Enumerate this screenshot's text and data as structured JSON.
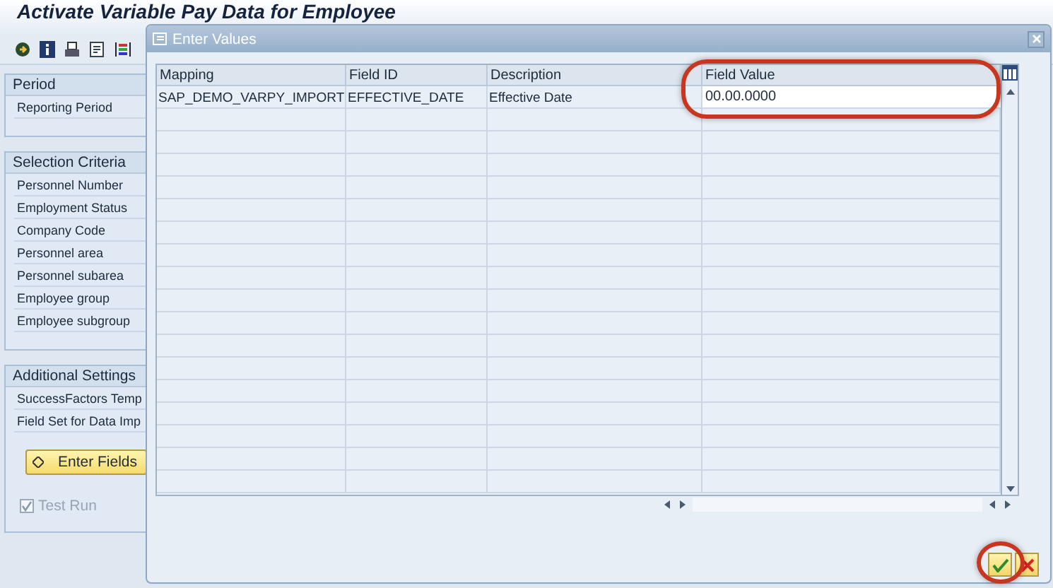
{
  "app": {
    "title": "Activate Variable Pay Data for Employee"
  },
  "groups": [
    {
      "title": "Period",
      "fields": [
        "Reporting Period"
      ]
    },
    {
      "title": "Selection Criteria",
      "fields": [
        "Personnel Number",
        "Employment Status",
        "Company Code",
        "Personnel area",
        "Personnel subarea",
        "Employee group",
        "Employee subgroup"
      ]
    },
    {
      "title": "Additional Settings",
      "fields": [
        "SuccessFactors Temp",
        "Field Set for Data Imp"
      ],
      "button": "Enter Fields",
      "checkbox": {
        "label": "Test Run",
        "checked": true,
        "disabled": true
      }
    }
  ],
  "dialog": {
    "title": "Enter Values",
    "columns": [
      {
        "label": "Mapping",
        "kind": "text"
      },
      {
        "label": "Field ID",
        "kind": "text"
      },
      {
        "label": "Description",
        "kind": "text"
      },
      {
        "label": "Field Value",
        "kind": "input"
      }
    ],
    "rows": [
      [
        "SAP_DEMO_VARPY_IMPORT",
        "EFFECTIVE_DATE",
        "Effective Date",
        "00.00.0000"
      ]
    ]
  }
}
